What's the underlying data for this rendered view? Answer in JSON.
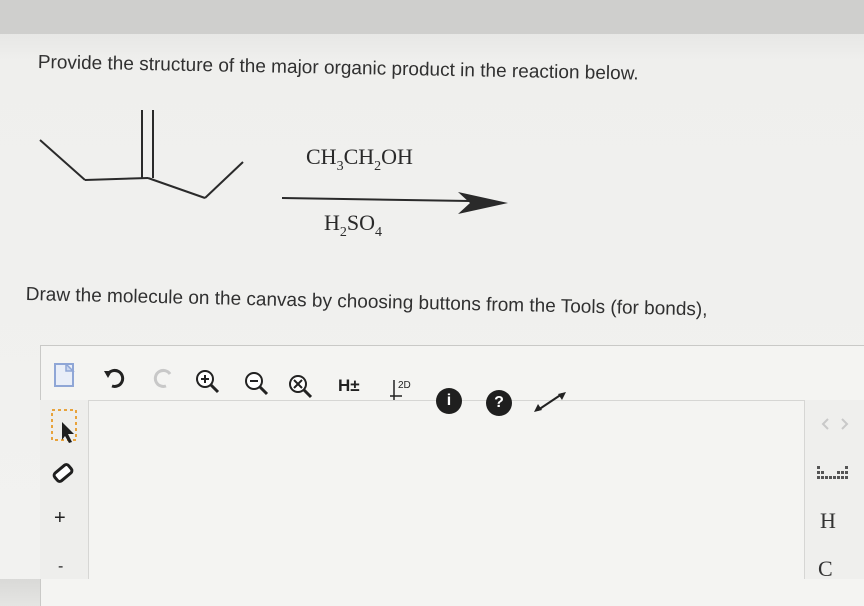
{
  "question": {
    "text": "Provide the structure of the major organic product in the reaction below."
  },
  "reaction": {
    "reagent_top": {
      "parts": [
        "CH",
        "3",
        "CH",
        "2",
        "OH"
      ]
    },
    "reagent_bottom": {
      "parts": [
        "H",
        "2",
        "SO",
        "4"
      ]
    }
  },
  "instruction": {
    "text": "Draw the molecule on the canvas by choosing buttons from the Tools (for bonds),"
  },
  "toolbar": {
    "h_toggle_label": "H±",
    "clean_2d_label": "2D",
    "info_label": "i",
    "help_label": "?"
  },
  "left_tools": {
    "add_label": "+",
    "minus_label": "-"
  },
  "right_tools": {
    "atom_h": "H",
    "atom_c": "C"
  },
  "colors": {
    "accent_orange": "#e8a33c",
    "dark_button": "#1f1f1f",
    "bond": "#2a2a2a"
  }
}
